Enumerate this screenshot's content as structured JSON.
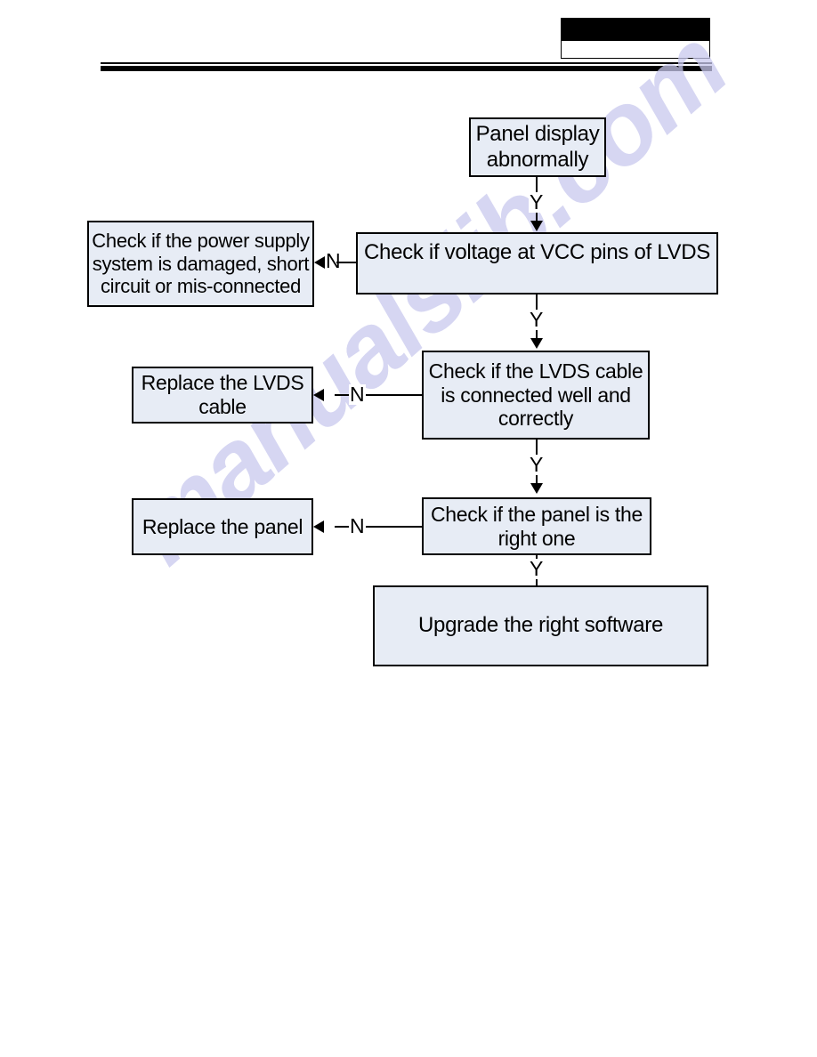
{
  "document": {
    "type": "service-manual-troubleshooting-flowchart",
    "page_background": "#ffffff",
    "header": {
      "black_bar_label": "",
      "white_bar_label": "",
      "rule_color": "#000000"
    },
    "watermark": {
      "text": "manualslib.com",
      "color": "#c9c9ee",
      "rotation_deg": -41
    }
  },
  "flowchart": {
    "box_fill": "#e7ecf5",
    "box_border": "#000000",
    "nodes": [
      {
        "id": "start",
        "label_lines": [
          "Panel display",
          "abnormally"
        ]
      },
      {
        "id": "check_vcc",
        "label_lines": [
          "Check if voltage at VCC pins of LVDS"
        ]
      },
      {
        "id": "power_supply",
        "label_lines": [
          "Check if the power supply",
          "system is damaged, short",
          "circuit or mis-connected"
        ]
      },
      {
        "id": "check_cable",
        "label_lines": [
          "Check if the LVDS cable",
          "is connected well and",
          "correctly"
        ]
      },
      {
        "id": "replace_cable",
        "label_lines": [
          "Replace the  LVDS",
          "cable"
        ]
      },
      {
        "id": "check_panel",
        "label_lines": [
          "Check if the panel is the",
          "right one"
        ]
      },
      {
        "id": "replace_panel",
        "label_lines": [
          "Replace the panel"
        ]
      },
      {
        "id": "upgrade_sw",
        "label_lines": [
          "Upgrade the right software"
        ]
      }
    ],
    "branch_labels": {
      "yes_1": "Y",
      "no_1": "N",
      "yes_2": "Y",
      "no_2": "N",
      "yes_3": "Y",
      "no_3": "N",
      "yes_4": "Y"
    }
  }
}
